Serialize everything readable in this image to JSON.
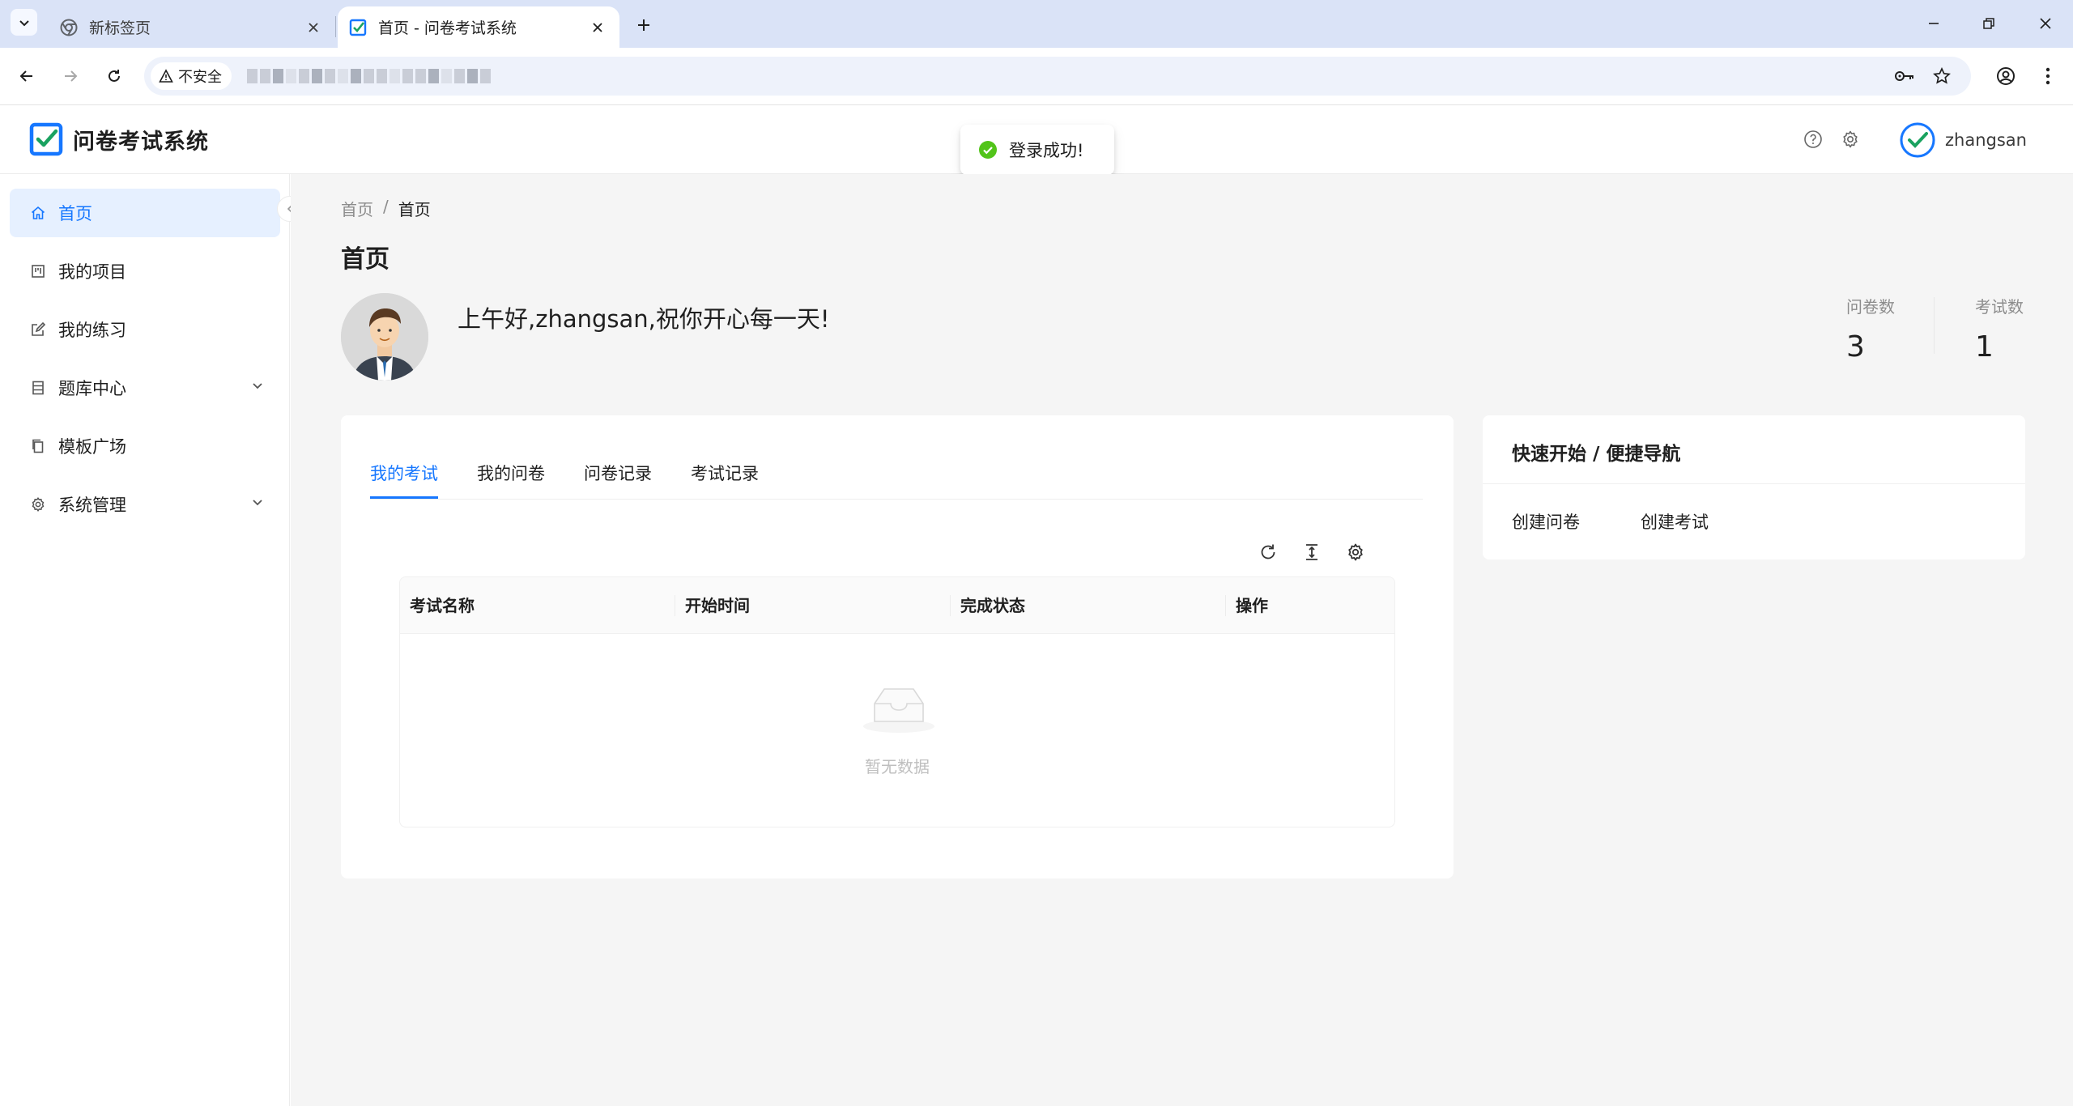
{
  "browser": {
    "tabs": [
      {
        "title": "新标签页",
        "active": false,
        "icon": "chrome-icon"
      },
      {
        "title": "首页 - 问卷考试系统",
        "active": true,
        "icon": "checkbox-logo-icon"
      }
    ],
    "security_label": "不安全",
    "url": ""
  },
  "app": {
    "title": "问卷考试系统",
    "username": "zhangsan",
    "accent_color": "#1677ff"
  },
  "toast": {
    "message": "登录成功!",
    "color": "#52c41a"
  },
  "sidebar": {
    "items": [
      {
        "label": "首页",
        "icon": "home-icon",
        "active": true
      },
      {
        "label": "我的项目",
        "icon": "project-icon",
        "active": false
      },
      {
        "label": "我的练习",
        "icon": "edit-icon",
        "active": false
      },
      {
        "label": "题库中心",
        "icon": "database-icon",
        "active": false,
        "expandable": true
      },
      {
        "label": "模板广场",
        "icon": "copy-icon",
        "active": false
      },
      {
        "label": "系统管理",
        "icon": "gear-icon",
        "active": false,
        "expandable": true
      }
    ]
  },
  "main": {
    "breadcrumb": [
      "首页",
      "首页"
    ],
    "breadcrumb_separator": "/",
    "page_title": "首页",
    "greeting": "上午好,zhangsan,祝你开心每一天!",
    "stats": [
      {
        "label": "问卷数",
        "value": "3"
      },
      {
        "label": "考试数",
        "value": "1"
      }
    ],
    "tabs": [
      "我的考试",
      "我的问卷",
      "问卷记录",
      "考试记录"
    ],
    "active_tab": "我的考试",
    "table": {
      "columns": [
        "考试名称",
        "开始时间",
        "完成状态",
        "操作"
      ],
      "rows": [],
      "empty_text": "暂无数据"
    }
  },
  "quick_start": {
    "title": "快速开始 / 便捷导航",
    "links": [
      "创建问卷",
      "创建考试"
    ]
  }
}
